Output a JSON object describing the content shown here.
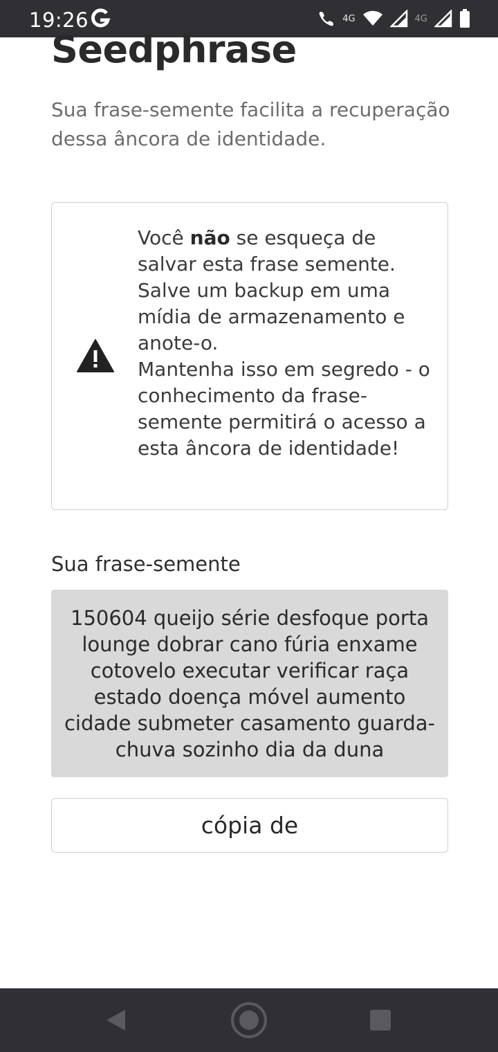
{
  "status_bar": {
    "time": "19:26",
    "network_label_1": "4G",
    "network_label_2": "4G"
  },
  "page": {
    "title": "Seedphrase",
    "subtitle": "Sua frase-semente facilita a recuperação dessa âncora de identidade.",
    "warning": {
      "text_before_bold": "Você ",
      "bold": "não",
      "text_after_bold": " se esqueça de salvar esta frase semente. Salve um backup em uma mídia de armazenamento e anote-o.",
      "text_second": "Mantenha isso em segredo - o conhecimento da frase-semente permitirá o acesso a esta âncora de identidade!"
    },
    "seed_label": "Sua frase-semente",
    "seed_phrase": "150604 queijo série desfoque porta lounge dobrar cano fúria enxame cotovelo executar verificar raça estado doença móvel aumento cidade submeter casamento guarda-chuva sozinho dia da duna",
    "copy_button": "cópia de"
  },
  "colors": {
    "system_bar": "#303034",
    "seed_background": "#d9d9d9",
    "border": "#cfcfcf"
  },
  "icons": [
    "google-g-icon",
    "wifi-calling-icon",
    "wifi-icon",
    "signal-icon",
    "battery-icon",
    "warning-icon",
    "nav-back-icon",
    "nav-home-icon",
    "nav-recents-icon"
  ]
}
